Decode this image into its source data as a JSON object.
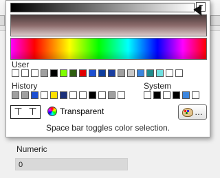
{
  "popup": {
    "user_label": "User",
    "history_label": "History",
    "system_label": "System",
    "transparent_label": "Transparent",
    "hint": "Space bar toggles color selection.",
    "palette_button": "…"
  },
  "user_colors": [
    "#ffffff",
    "#ffffff",
    "#ffffff",
    "#a0a0a0",
    "#000000",
    "#80ff00",
    "#2f5f10",
    "#e00000",
    "#1c4fd2",
    "#0f3e9e",
    "#1a3fa0",
    "#a0a0a0",
    "#c8c8c8",
    "#3c86df",
    "#1f8c8c",
    "#6fe0e0",
    "#ffffff",
    "#ffffff"
  ],
  "history_colors": [
    "#a0a0a0",
    "#a0a0a0",
    "#1c4fd2",
    "#ffffff",
    "#ffe000",
    "#1a2f7a",
    "#ffffff",
    "#ffffff",
    "#000000",
    "#ffffff",
    "#a0a0a0",
    "#ffffff"
  ],
  "system_colors": [
    "#ffffff",
    "#000000",
    "#ffffff",
    "#000000",
    "#3c86df",
    "#ffffff"
  ],
  "numeric": {
    "label": "Numeric",
    "value": "0"
  }
}
